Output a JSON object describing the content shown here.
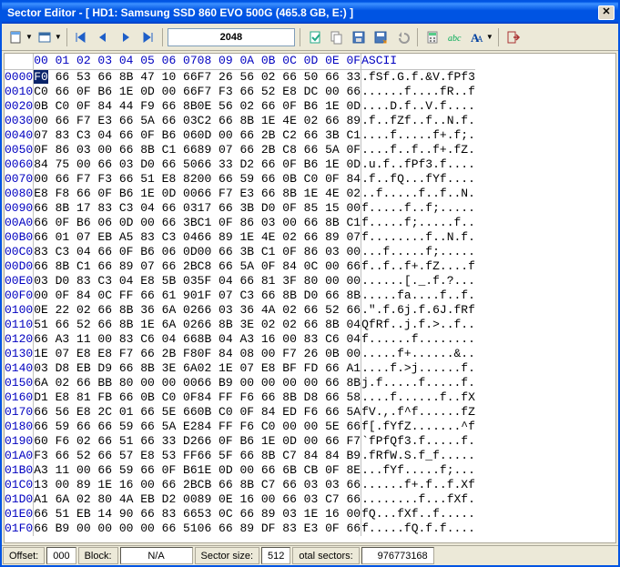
{
  "title": "Sector Editor - [ HD1: Samsung SSD 860 EVO 500G (465.8 GB, E:) ]",
  "sector_input": "2048",
  "header": {
    "offset_blank": "    ",
    "cols1": "00 01 02 03 04 05 06 07",
    "cols2": "08 09 0A 0B 0C 0D 0E 0F",
    "ascii": "ASCII"
  },
  "rows": [
    {
      "off": "0000",
      "h1": "F0 66 53 66 8B 47 10 66",
      "h2": "F7 26 56 02 66 50 66 33",
      "asc": ".fSf.G.f.&V.fPf3",
      "cur": 0
    },
    {
      "off": "0010",
      "h1": "C0 66 0F B6 1E 0D 00 66",
      "h2": "F7 F3 66 52 E8 DC 00 66",
      "asc": "......f....fR..f"
    },
    {
      "off": "0020",
      "h1": "0B C0 0F 84 44 F9 66 8B",
      "h2": "0E 56 02 66 0F B6 1E 0D",
      "asc": "....D.f..V.f...."
    },
    {
      "off": "0030",
      "h1": "00 66 F7 E3 66 5A 66 03",
      "h2": "C2 66 8B 1E 4E 02 66 89",
      "asc": ".f..fZf..f..N.f."
    },
    {
      "off": "0040",
      "h1": "07 83 C3 04 66 0F B6 06",
      "h2": "0D 00 66 2B C2 66 3B C1",
      "asc": "....f.....f+.f;."
    },
    {
      "off": "0050",
      "h1": "0F 86 03 00 66 8B C1 66",
      "h2": "89 07 66 2B C8 66 5A 0F",
      "asc": "....f..f..f+.fZ."
    },
    {
      "off": "0060",
      "h1": "84 75 00 66 03 D0 66 50",
      "h2": "66 33 D2 66 0F B6 1E 0D",
      "asc": ".u.f..fPf3.f...."
    },
    {
      "off": "0070",
      "h1": "00 66 F7 F3 66 51 E8 82",
      "h2": "00 66 59 66 0B C0 0F 84",
      "asc": ".f..fQ...fYf...."
    },
    {
      "off": "0080",
      "h1": "E8 F8 66 0F B6 1E 0D 00",
      "h2": "66 F7 E3 66 8B 1E 4E 02",
      "asc": "..f.....f..f..N."
    },
    {
      "off": "0090",
      "h1": "66 8B 17 83 C3 04 66 03",
      "h2": "17 66 3B D0 0F 85 15 00",
      "asc": "f.....f..f;....."
    },
    {
      "off": "00A0",
      "h1": "66 0F B6 06 0D 00 66 3B",
      "h2": "C1 0F 86 03 00 66 8B C1",
      "asc": "f.....f;.....f.."
    },
    {
      "off": "00B0",
      "h1": "66 01 07 EB A5 83 C3 04",
      "h2": "66 89 1E 4E 02 66 89 07",
      "asc": "f........f..N.f."
    },
    {
      "off": "00C0",
      "h1": "83 C3 04 66 0F B6 06 0D",
      "h2": "00 66 3B C1 0F 86 03 00",
      "asc": "...f.....f;....."
    },
    {
      "off": "00D0",
      "h1": "66 8B C1 66 89 07 66 2B",
      "h2": "C8 66 5A 0F 84 0C 00 66",
      "asc": "f..f..f+.fZ....f"
    },
    {
      "off": "00E0",
      "h1": "03 D0 83 C3 04 E8 5B 03",
      "h2": "5F 04 66 81 3F 80 00 00",
      "asc": "......[._.f.?..."
    },
    {
      "off": "00F0",
      "h1": "00 0F 84 0C FF 66 61 90",
      "h2": "1F 07 C3 66 8B D0 66 8B",
      "asc": ".....fa....f..f."
    },
    {
      "off": "0100",
      "h1": "0E 22 02 66 8B 36 6A 02",
      "h2": "66 03 36 4A 02 66 52 66",
      "asc": ".\".f.6j.f.6J.fRf"
    },
    {
      "off": "0110",
      "h1": "51 66 52 66 8B 1E 6A 02",
      "h2": "66 8B 3E 02 02 66 8B 04",
      "asc": "QfRf..j.f.>..f.."
    },
    {
      "off": "0120",
      "h1": "66 A3 11 00 83 C6 04 66",
      "h2": "8B 04 A3 16 00 83 C6 04",
      "asc": "f......f........"
    },
    {
      "off": "0130",
      "h1": "1E 07 E8 E8 F7 66 2B F8",
      "h2": "0F 84 08 00 F7 26 0B 00",
      "asc": ".....f+......&.."
    },
    {
      "off": "0140",
      "h1": "03 D8 EB D9 66 8B 3E 6A",
      "h2": "02 1E 07 E8 BF FD 66 A1",
      "asc": "....f.>j......f."
    },
    {
      "off": "0150",
      "h1": "6A 02 66 BB 80 00 00 00",
      "h2": "66 B9 00 00 00 00 66 8B",
      "asc": "j.f.....f.....f."
    },
    {
      "off": "0160",
      "h1": "D1 E8 81 FB 66 0B C0 0F",
      "h2": "84 FF F6 66 8B D8 66 58",
      "asc": "....f......f..fX"
    },
    {
      "off": "0170",
      "h1": "66 56 E8 2C 01 66 5E 66",
      "h2": "0B C0 0F 84 ED F6 66 5A",
      "asc": "fV.,.f^f......fZ"
    },
    {
      "off": "0180",
      "h1": "66 59 66 66 59 66 5A E2",
      "h2": "84 FF F6 C0 00 00 5E 66",
      "asc": "f[.fYfZ.......^f"
    },
    {
      "off": "0190",
      "h1": "60 F6 02 66 51 66 33 D2",
      "h2": "66 0F B6 1E 0D 00 66 F7",
      "asc": "`fPfQf3.f.....f."
    },
    {
      "off": "01A0",
      "h1": "F3 66 52 66 57 E8 53 FF",
      "h2": "66 5F 66 8B C7 84 84 B9",
      "asc": ".fRfW.S.f_f....."
    },
    {
      "off": "01B0",
      "h1": "A3 11 00 66 59 66 0F B6",
      "h2": "1E 0D 00 66 6B CB 0F 8E",
      "asc": "...fYf.....f;..."
    },
    {
      "off": "01C0",
      "h1": "13 00 89 1E 16 00 66 2B",
      "h2": "CB 66 8B C7 66 03 03 66",
      "asc": "......f+.f..f.Xf"
    },
    {
      "off": "01D0",
      "h1": "A1 6A 02 80 4A EB D2 00",
      "h2": "89 0E 16 00 66 03 C7 66",
      "asc": "........f...fXf."
    },
    {
      "off": "01E0",
      "h1": "66 51 EB 14 90 66 83 66",
      "h2": "53 0C 66 89 03 1E 16 00",
      "asc": "fQ...fXf..f....."
    },
    {
      "off": "01F0",
      "h1": "66 B9 00 00 00 00 66 51",
      "h2": "06 66 89 DF 83 E3 0F 66",
      "asc": "f.....fQ.f.f...."
    }
  ],
  "status": {
    "offset_label": "Offset:",
    "offset_val": "000",
    "block_label": "Block:",
    "block_val": "N/A",
    "secsize_label": "Sector size:",
    "secsize_val": "512",
    "total_label": "otal sectors:",
    "total_val": "976773168"
  },
  "icons": {
    "newdoc": "newdoc",
    "view": "view",
    "first": "first",
    "prev": "prev",
    "next": "next",
    "last": "last",
    "go": "go",
    "copy": "copy",
    "save": "save",
    "saveas": "saveas",
    "undo": "undo",
    "calc": "calc",
    "find": "find",
    "font": "font",
    "exit": "exit"
  }
}
